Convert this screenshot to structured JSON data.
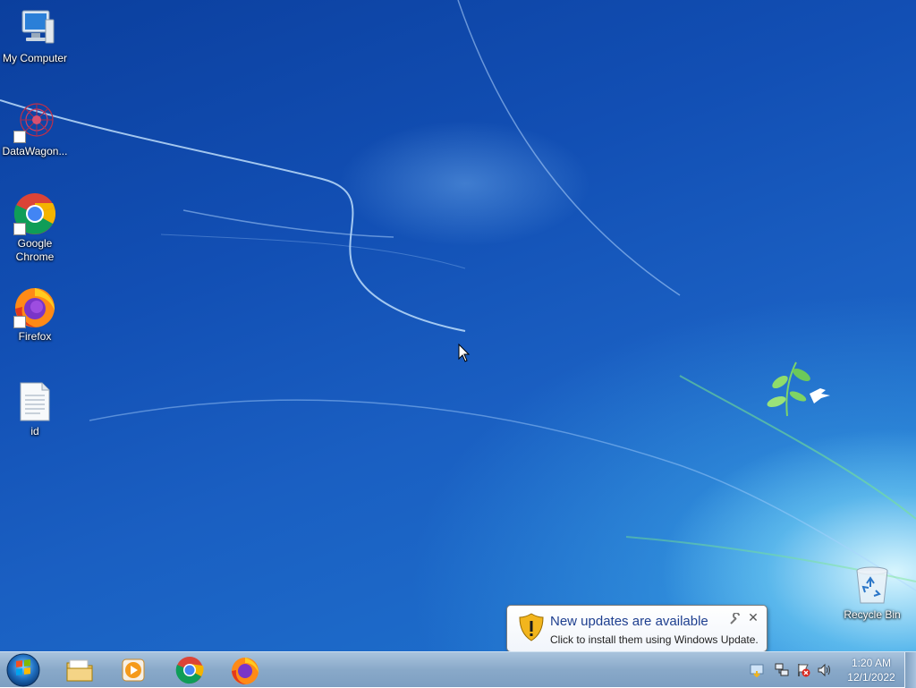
{
  "desktop": {
    "icons": [
      {
        "label": "My Computer",
        "icon": "computer-icon"
      },
      {
        "label": "DataWagon...",
        "icon": "datawagon-icon"
      },
      {
        "label": "Google Chrome",
        "icon": "chrome-icon"
      },
      {
        "label": "Firefox",
        "icon": "firefox-icon"
      },
      {
        "label": "id",
        "icon": "text-file-icon"
      },
      {
        "label": "Recycle Bin",
        "icon": "recycle-bin-icon"
      }
    ]
  },
  "notification": {
    "title": "New updates are available",
    "text": "Click to install them using Windows Update.",
    "icon": "warning-shield-icon",
    "close_glyph": "✕"
  },
  "taskbar": {
    "pinned": [
      {
        "name": "Windows Explorer",
        "icon": "folder-icon"
      },
      {
        "name": "Windows Media Player",
        "icon": "media-player-icon"
      },
      {
        "name": "Google Chrome",
        "icon": "chrome-icon"
      },
      {
        "name": "Firefox",
        "icon": "firefox-icon"
      }
    ],
    "tray": {
      "time": "1:20 AM",
      "date": "12/1/2022",
      "icons": [
        "windows-update-icon",
        "network-icon",
        "action-center-icon",
        "volume-icon"
      ]
    }
  },
  "colors": {
    "wallpaper": "#124fb4",
    "taskbar": "#89a9c9",
    "balloon_title": "#1e3f8f"
  }
}
